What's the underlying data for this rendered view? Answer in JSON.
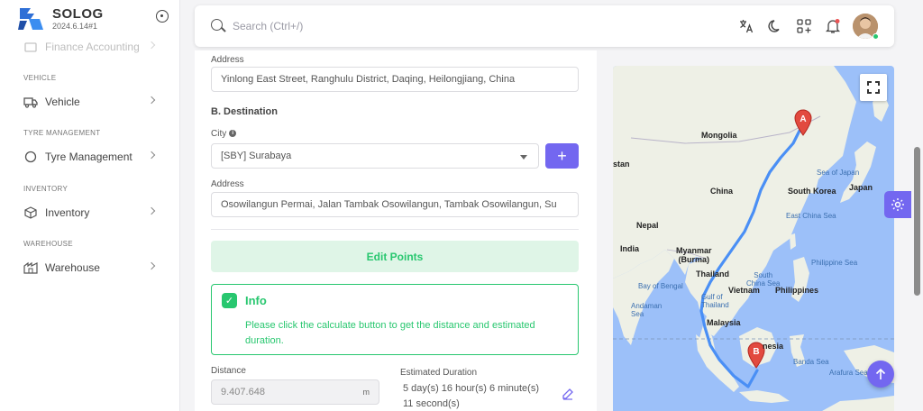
{
  "brand": {
    "name": "SOLOG",
    "version": "2024.6.14#1"
  },
  "sidebar": {
    "faded_item": "Finance Accounting",
    "sections": [
      {
        "label": "VEHICLE",
        "item": "Vehicle",
        "icon": "truck-icon"
      },
      {
        "label": "TYRE MANAGEMENT",
        "item": "Tyre Management",
        "icon": "circle-icon"
      },
      {
        "label": "INVENTORY",
        "item": "Inventory",
        "icon": "box-icon"
      },
      {
        "label": "WAREHOUSE",
        "item": "Warehouse",
        "icon": "warehouse-icon"
      }
    ]
  },
  "search": {
    "placeholder": "Search (Ctrl+/)"
  },
  "form": {
    "origin_address_label": "Address",
    "origin_address": "Yinlong East Street, Ranghulu District, Daqing, Heilongjiang, China",
    "destination_title": "B. Destination",
    "city_label": "City",
    "city_value": "[SBY] Surabaya",
    "dest_address_label": "Address",
    "dest_address": "Osowilangun Permai, Jalan Tambak Osowilangun, Tambak Osowilangun, Su",
    "edit_points": "Edit Points",
    "info_title": "Info",
    "info_text": "Please click the calculate button to get the distance and estimated duration.",
    "distance_label": "Distance",
    "distance_value": "9.407.648",
    "distance_unit": "m",
    "duration_label": "Estimated Duration",
    "duration_line1": "5 day(s) 16 hour(s) 6 minute(s)",
    "duration_line2": "11 second(s)"
  },
  "map": {
    "labels": {
      "mongolia": "Mongolia",
      "china": "China",
      "south_korea": "South Korea",
      "japan": "Japan",
      "sea_of_japan": "Sea of Japan",
      "east_china_sea": "East China Sea",
      "stan": "stan",
      "nepal": "Nepal",
      "india": "India",
      "myanmar": "Myanmar\n(Burma)",
      "thailand": "Thailand",
      "south_china_sea": "South\nChina Sea",
      "philippine_sea": "Philippine Sea",
      "bay_of_bengal": "Bay of Bengal",
      "vietnam": "Vietnam",
      "philippines": "Philippines",
      "gulf_of_thailand": "Gulf of\nThailand",
      "andaman_sea": "Andaman\nSea",
      "malaysia": "Malaysia",
      "indonesia": "nesia",
      "banda_sea": "Banda Sea",
      "arafura_sea": "Arafura Sea",
      "marker_a": "A",
      "marker_b": "B"
    }
  },
  "colors": {
    "accent": "#7367f0",
    "success": "#28c76f",
    "water": "#9cc0f9",
    "land": "#eef0e6",
    "route": "#4a8ff5"
  }
}
